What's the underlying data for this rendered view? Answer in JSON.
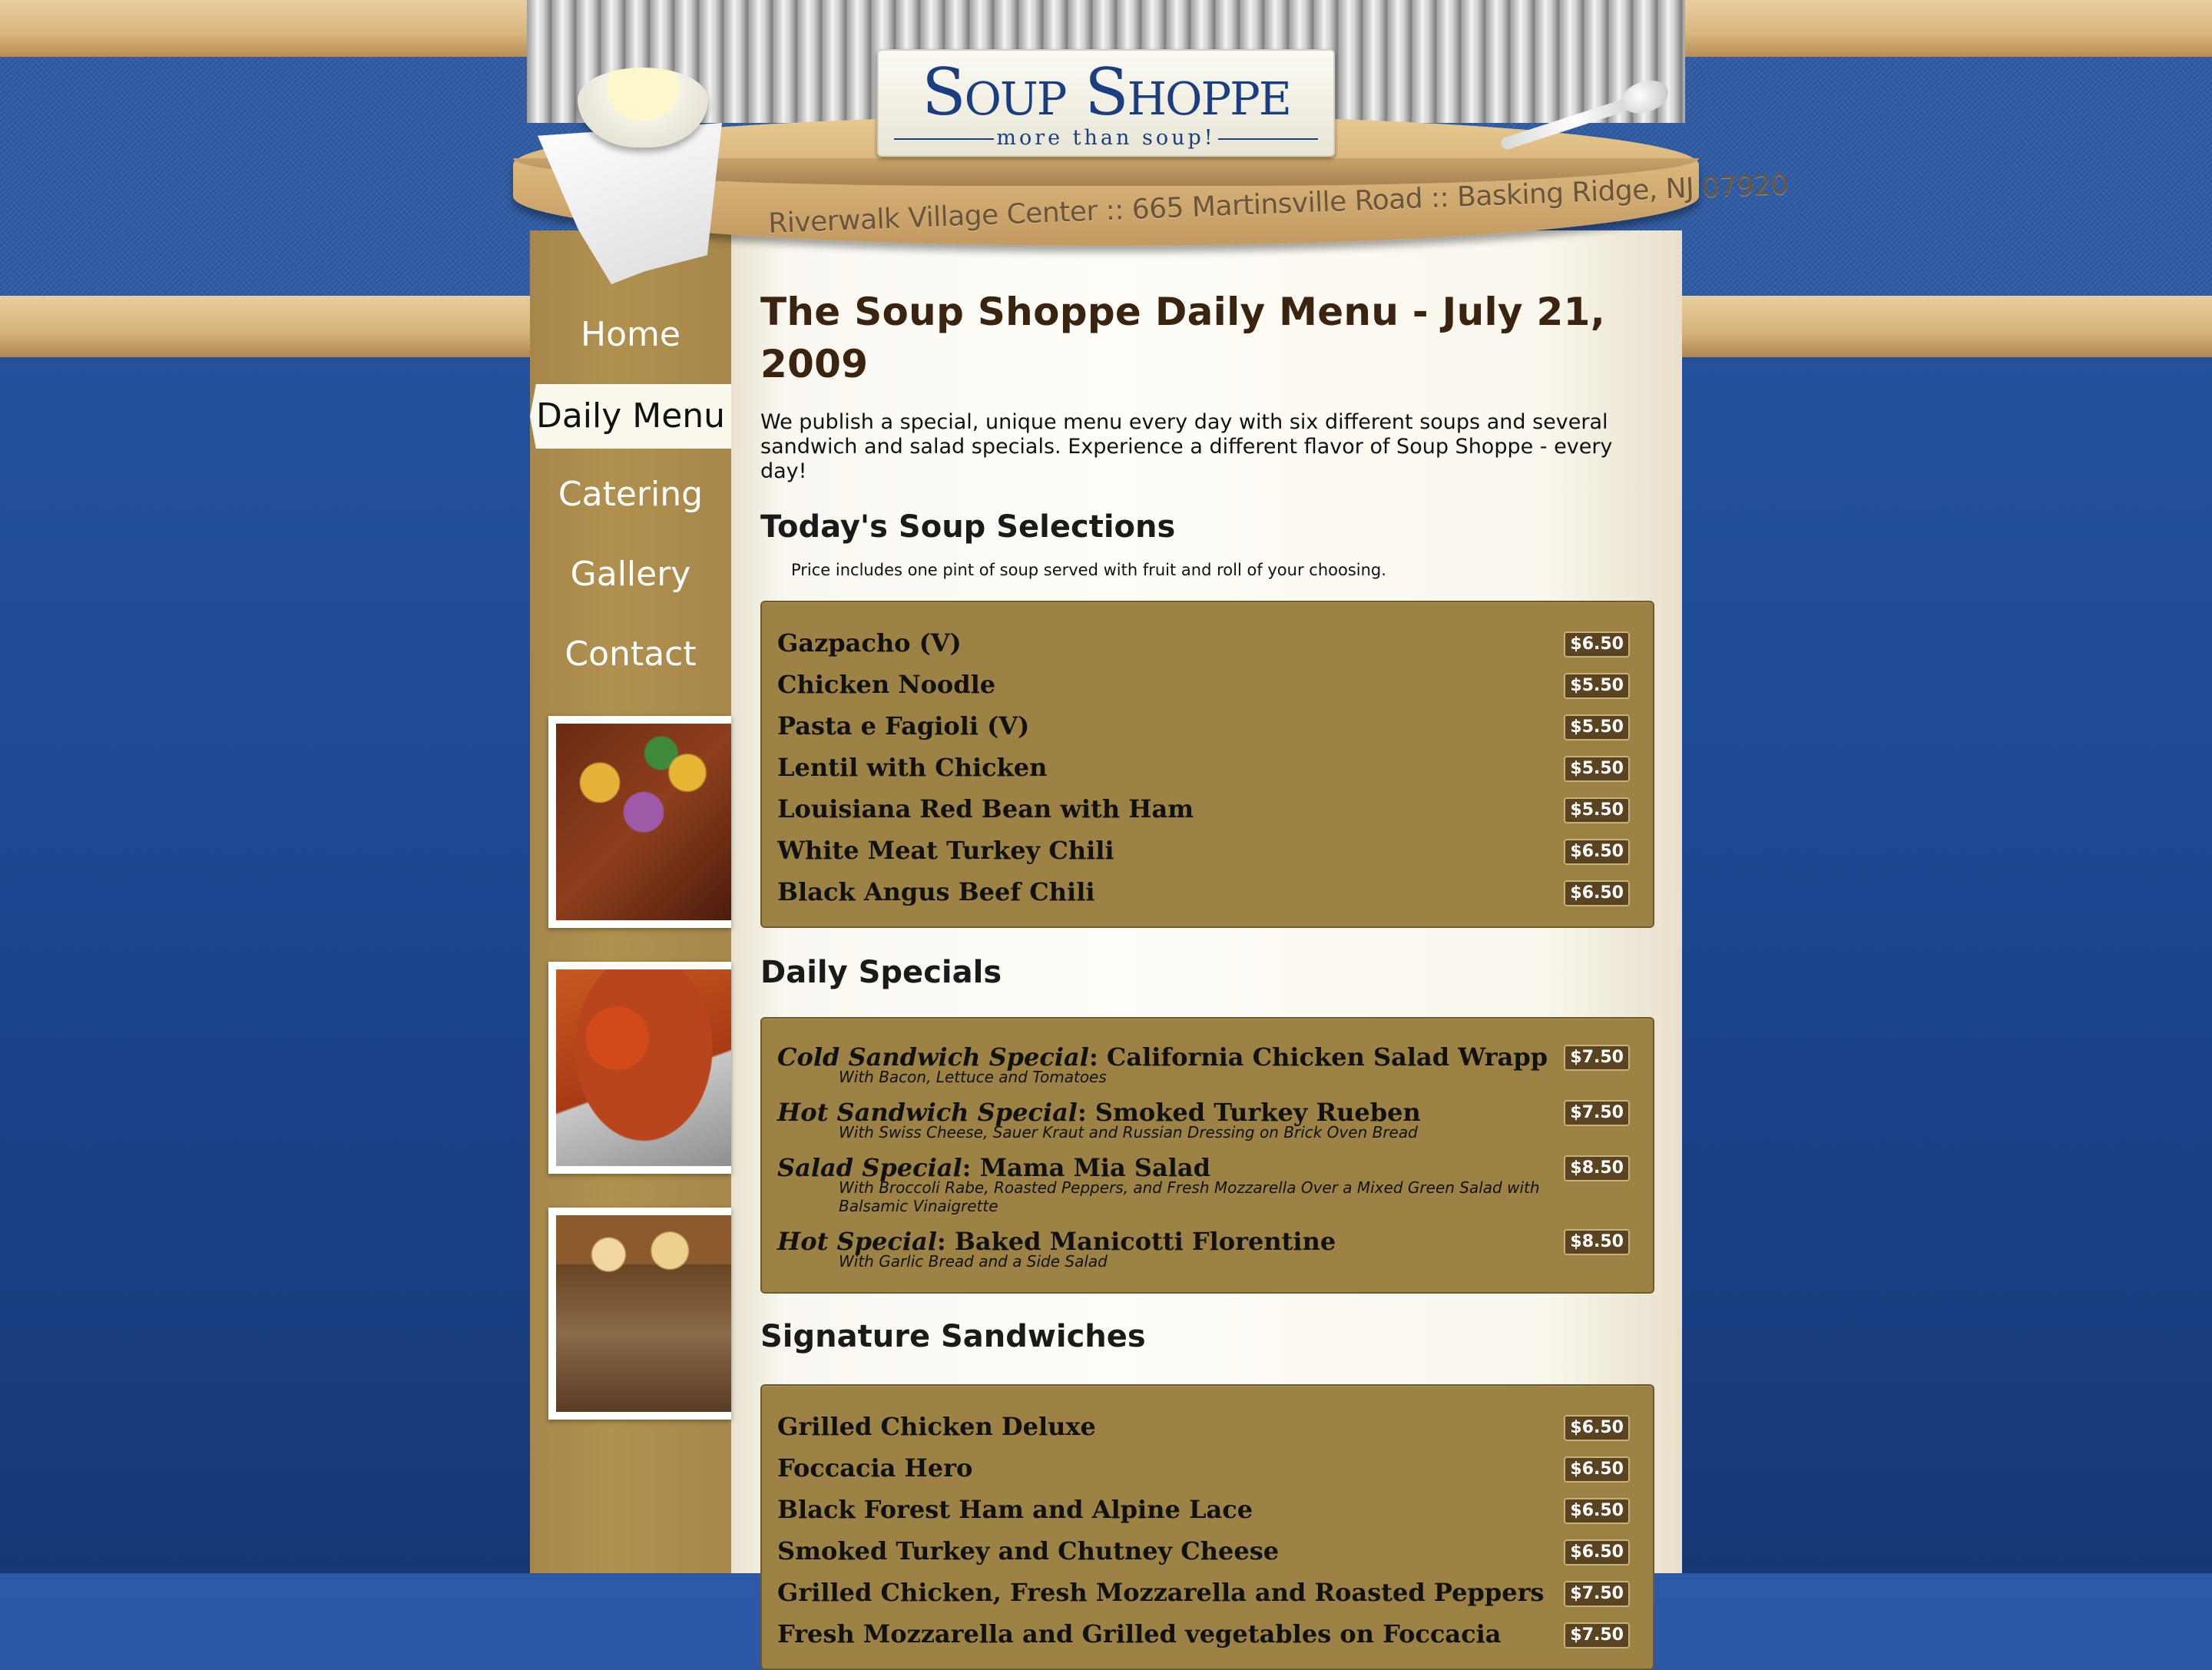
{
  "header": {
    "logo_name": "Soup Shoppe",
    "logo_tagline": "more than soup!",
    "address": "Riverwalk Village Center :: 665 Martinsville Road :: Basking Ridge, NJ 07920"
  },
  "nav": {
    "items": [
      {
        "label": "Home"
      },
      {
        "label": "Daily Menu"
      },
      {
        "label": "Catering"
      },
      {
        "label": "Gallery"
      },
      {
        "label": "Contact"
      }
    ]
  },
  "page": {
    "title": "The Soup Shoppe Daily Menu - July 21, 2009",
    "intro": "We publish a special, unique menu every day with six different soups and several sandwich and salad specials. Experience a different flavor of Soup Shoppe - every day!"
  },
  "soups": {
    "heading": "Today's Soup Selections",
    "note": "Price includes one pint of soup served with fruit and roll of your choosing.",
    "items": [
      {
        "name": "Gazpacho (V)",
        "price": "$6.50"
      },
      {
        "name": "Chicken Noodle",
        "price": "$5.50"
      },
      {
        "name": "Pasta e Fagioli (V)",
        "price": "$5.50"
      },
      {
        "name": "Lentil with Chicken",
        "price": "$5.50"
      },
      {
        "name": "Louisiana Red Bean with Ham",
        "price": "$5.50"
      },
      {
        "name": "White Meat Turkey Chili",
        "price": "$6.50"
      },
      {
        "name": "Black Angus Beef Chili",
        "price": "$6.50"
      }
    ]
  },
  "specials": {
    "heading": "Daily Specials",
    "items": [
      {
        "type": "Cold Sandwich Special",
        "name": ": California Chicken Salad Wrapp",
        "desc": "With Bacon, Lettuce and Tomatoes",
        "price": "$7.50"
      },
      {
        "type": "Hot Sandwich Special",
        "name": ": Smoked Turkey Rueben",
        "desc": "With Swiss Cheese, Sauer Kraut and Russian Dressing on Brick Oven Bread",
        "price": "$7.50"
      },
      {
        "type": "Salad Special",
        "name": ": Mama Mia Salad",
        "desc": "With Broccoli Rabe, Roasted Peppers, and Fresh Mozzarella Over a Mixed Green Salad with Balsamic Vinaigrette",
        "price": "$8.50"
      },
      {
        "type": "Hot Special",
        "name": ": Baked Manicotti Florentine",
        "desc": "With Garlic Bread and a Side Salad",
        "price": "$8.50"
      }
    ]
  },
  "sandwiches": {
    "heading": "Signature Sandwiches",
    "items": [
      {
        "name": "Grilled Chicken Deluxe",
        "price": "$6.50"
      },
      {
        "name": "Foccacia Hero",
        "price": "$6.50"
      },
      {
        "name": "Black Forest Ham and Alpine Lace",
        "price": "$6.50"
      },
      {
        "name": "Smoked Turkey and Chutney Cheese",
        "price": "$6.50"
      },
      {
        "name": "Grilled Chicken, Fresh Mozzarella and Roasted Peppers",
        "price": "$7.50"
      },
      {
        "name": "Fresh Mozzarella and Grilled vegetables on Foccacia",
        "price": "$7.50"
      }
    ]
  },
  "colors": {
    "menu_box": "#9c8345",
    "sidebar": "#a9894d",
    "title": "#3a2410",
    "logo": "#1b3e80"
  }
}
